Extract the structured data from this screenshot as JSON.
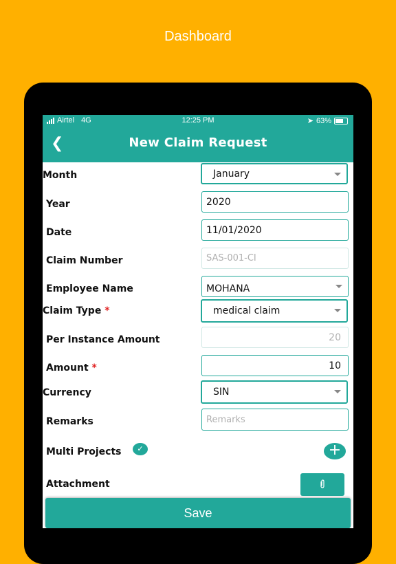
{
  "promo": {
    "title": "Dashboard"
  },
  "status_bar": {
    "carrier": "Airtel",
    "network": "4G",
    "time": "12:25 PM",
    "battery": "63%"
  },
  "header": {
    "back_icon": "chevron-left-icon",
    "title": "New Claim Request"
  },
  "form": {
    "month": {
      "label": "Month",
      "value": "January"
    },
    "year": {
      "label": "Year",
      "value": "2020"
    },
    "date": {
      "label": "Date",
      "value": "11/01/2020"
    },
    "claim_number": {
      "label": "Claim Number",
      "placeholder": "SAS-001-CI"
    },
    "employee_name": {
      "label": "Employee Name",
      "value": "MOHANA"
    },
    "claim_type": {
      "label": "Claim Type",
      "required": "*",
      "value": "medical claim"
    },
    "per_instance_amount": {
      "label": "Per Instance Amount",
      "value": "20"
    },
    "amount": {
      "label": "Amount",
      "required": "*",
      "value": "10"
    },
    "currency": {
      "label": "Currency",
      "value": "SIN"
    },
    "remarks": {
      "label": "Remarks",
      "placeholder": "Remarks"
    },
    "multi_projects": {
      "label": "Multi Projects",
      "check_icon": "check-circle-icon",
      "add_icon": "plus-icon"
    },
    "attachment": {
      "label": "Attachment",
      "icon": "paperclip-icon"
    }
  },
  "save_button": {
    "label": "Save"
  },
  "colors": {
    "background": "#FFB000",
    "accent": "#22A89A",
    "required": "#E02020"
  }
}
